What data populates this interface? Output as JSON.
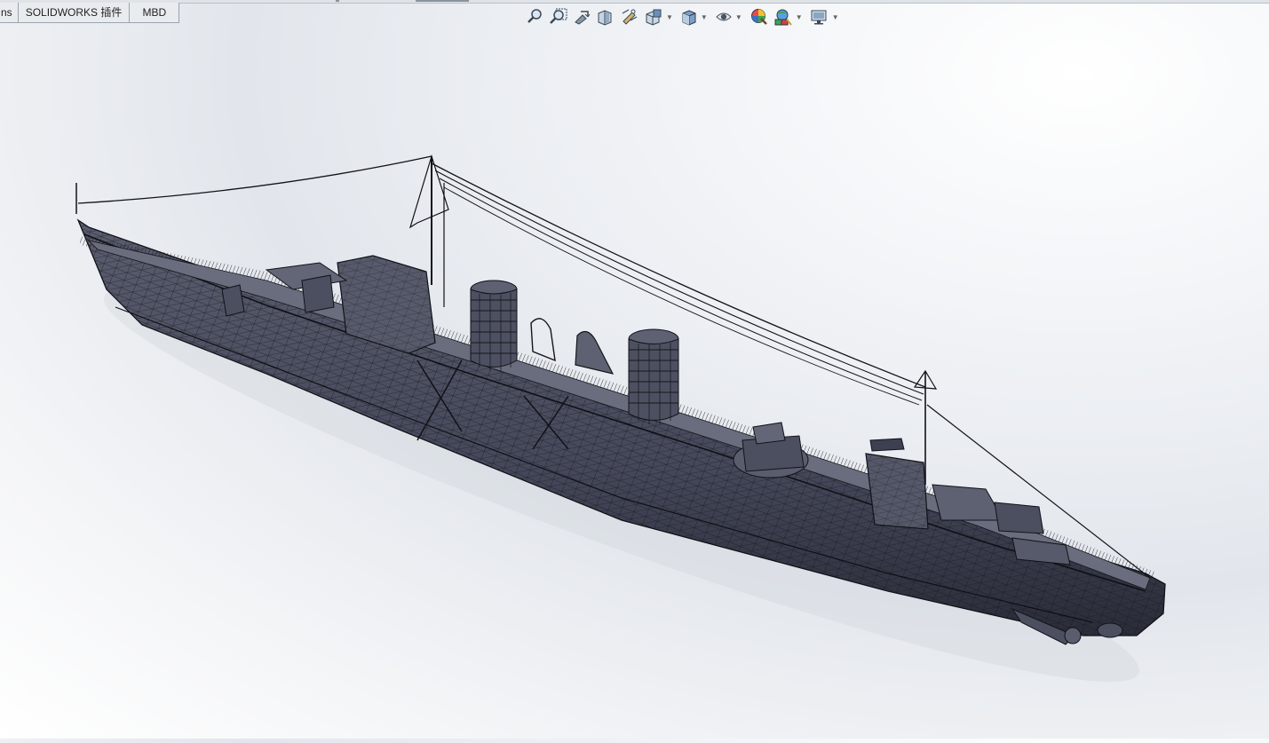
{
  "app": "SOLIDWORKS",
  "command_tabs": [
    {
      "label": "ns"
    },
    {
      "label": "SOLIDWORKS 插件"
    },
    {
      "label": "MBD"
    }
  ],
  "heads_up_toolbar": [
    {
      "icon": "zoom-to-fit-icon",
      "has_dropdown": false
    },
    {
      "icon": "zoom-to-area-icon",
      "has_dropdown": false
    },
    {
      "icon": "previous-view-icon",
      "has_dropdown": false
    },
    {
      "icon": "section-view-icon",
      "has_dropdown": false
    },
    {
      "icon": "dynamic-annotation-views-icon",
      "has_dropdown": false
    },
    {
      "icon": "view-orientation-icon",
      "has_dropdown": true
    },
    {
      "icon": "display-style-icon",
      "has_dropdown": true
    },
    {
      "icon": "hide-show-items-icon",
      "has_dropdown": true
    },
    {
      "icon": "edit-appearance-icon",
      "has_dropdown": false
    },
    {
      "icon": "apply-scene-icon",
      "has_dropdown": true
    },
    {
      "icon": "view-settings-icon",
      "has_dropdown": true
    }
  ],
  "model": {
    "description_icon": "ship-model-icon",
    "display_mode": "shaded-with-edges",
    "colors": {
      "hull": "#4a4d5c",
      "edges": "#15161c",
      "highlight": "#8a8d9c"
    }
  },
  "colors": {
    "viewport_top": "#ffffff",
    "viewport_mid": "#e2e6ec",
    "tab_bg": "#e9ecef",
    "tab_border": "#9aa3ad"
  }
}
